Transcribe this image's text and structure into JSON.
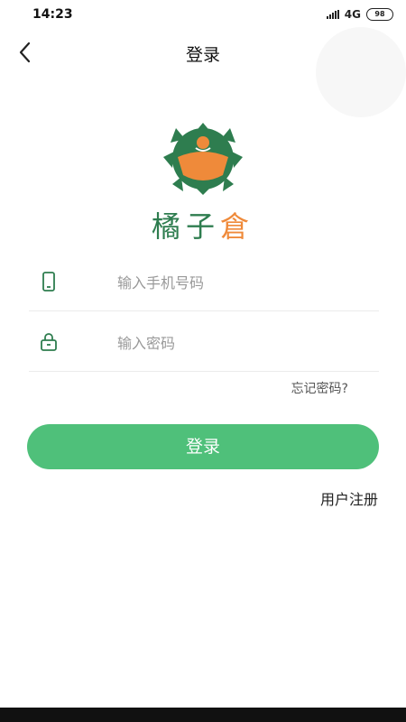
{
  "status": {
    "time": "14:23",
    "network": "4G",
    "battery": "98"
  },
  "nav": {
    "title": "登录",
    "back_icon": "chevron-left-icon"
  },
  "brand": {
    "part1": "橘子",
    "part2": "倉"
  },
  "form": {
    "phone_placeholder": "输入手机号码",
    "phone_value": "",
    "phone_icon": "phone-icon",
    "password_placeholder": "输入密码",
    "password_value": "",
    "password_icon": "lock-icon",
    "forgot_label": "忘记密码?",
    "login_label": "登录",
    "register_label": "用户注册"
  },
  "colors": {
    "primary": "#4fc07a",
    "brand_green": "#2e7d4f",
    "brand_orange": "#ef8a3a"
  }
}
